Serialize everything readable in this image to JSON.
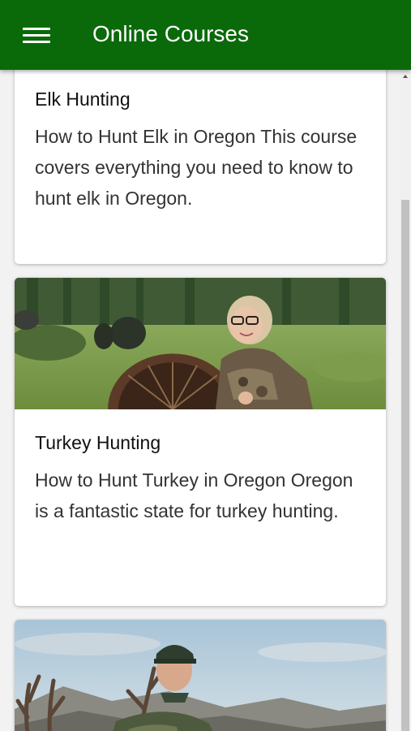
{
  "header": {
    "title": "Online Courses",
    "menu_icon": "hamburger-menu-icon",
    "background": "#0a6a0a"
  },
  "courses": [
    {
      "title": "Elk Hunting",
      "description": "How to Hunt Elk in Oregon This course covers everything you need to know to hunt elk in Oregon."
    },
    {
      "title": "Turkey Hunting",
      "description": "How to Hunt Turkey in Oregon Oregon is a fantastic state for turkey hunting."
    }
  ]
}
